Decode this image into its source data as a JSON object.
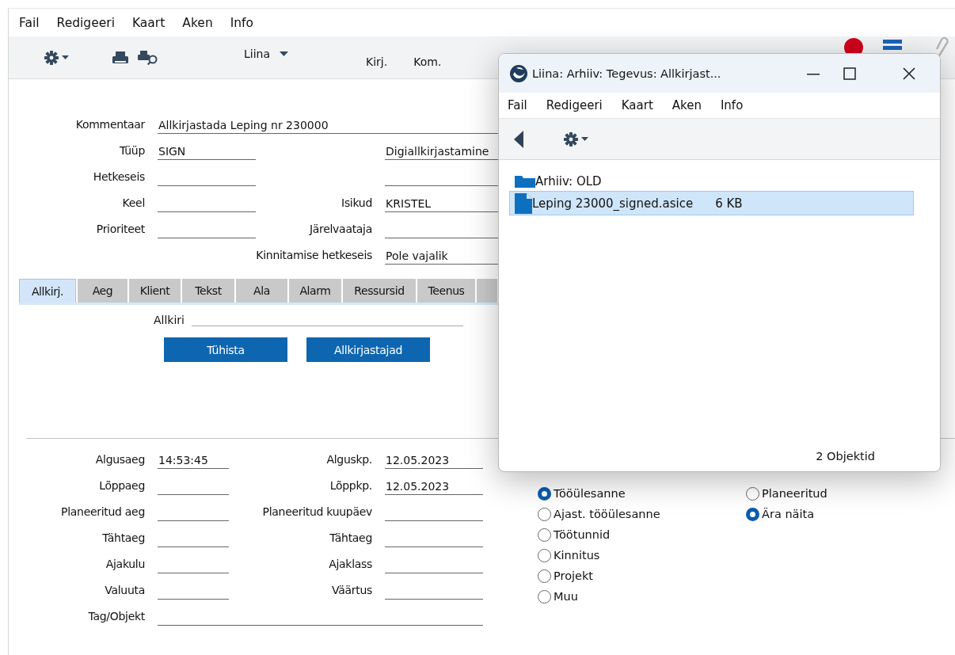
{
  "main_window": {
    "menu": [
      "Fail",
      "Redigeeri",
      "Kaart",
      "Aken",
      "Info"
    ],
    "toolbar": {
      "user_menu": "Liina",
      "buttons": [
        "Kirj.",
        "Kom."
      ]
    },
    "header_rows": [
      {
        "kind": "wide",
        "left": {
          "label": "Kommentaar",
          "value": "Allkirjastada Leping nr 230000"
        }
      },
      {
        "kind": "pair",
        "left": {
          "label": "Tüüp",
          "value": "SIGN"
        },
        "right": {
          "value": "Digiallkirjastamine"
        }
      },
      {
        "kind": "pair",
        "left": {
          "label": "Hetkeseis"
        },
        "right": {
          "kind": "field"
        }
      },
      {
        "kind": "pair",
        "left": {
          "label": "Keel"
        },
        "right": {
          "label": "Isikud",
          "value": "KRISTEL"
        }
      },
      {
        "kind": "pair",
        "left": {
          "label": "Prioriteet"
        },
        "right": {
          "label": "Järelvaataja"
        }
      },
      {
        "kind": "pair",
        "right": {
          "label": "Kinnitamise hetkeseis",
          "value": "Pole vajalik"
        }
      }
    ],
    "tabs": [
      {
        "label": "Allkirj.",
        "selected": true
      },
      {
        "label": "Aeg",
        "selected": false
      },
      {
        "label": "Klient",
        "selected": false
      },
      {
        "label": "Tekst",
        "selected": false
      },
      {
        "label": "Ala",
        "selected": false
      },
      {
        "label": "Alarm",
        "selected": false
      },
      {
        "label": "Ressursid",
        "selected": false
      },
      {
        "label": "Teenus",
        "selected": false
      }
    ],
    "signature": {
      "label": "Allkiri",
      "buttons": [
        "Tühista",
        "Allkirjastajad"
      ]
    },
    "time_rows": [
      {
        "kind": "pair",
        "left": {
          "label": "Algusaeg",
          "value": "14:53:45"
        },
        "right": {
          "label": "Alguskp.",
          "value": "12.05.2023"
        }
      },
      {
        "kind": "pair",
        "left": {
          "label": "Lõppaeg"
        },
        "right": {
          "label": "Lõppkp.",
          "value": "12.05.2023"
        }
      },
      {
        "kind": "pair",
        "left": {
          "label": "Planeeritud aeg"
        },
        "right": {
          "label": "Planeeritud kuupäev"
        }
      },
      {
        "kind": "pair",
        "left": {
          "label": "Tähtaeg"
        },
        "right": {
          "label": "Tähtaeg"
        }
      },
      {
        "kind": "pair",
        "left": {
          "label": "Ajakulu"
        },
        "right": {
          "label": "Ajaklass"
        }
      },
      {
        "kind": "pair",
        "left": {
          "label": "Valuuta"
        },
        "right": {
          "label": "Väärtus"
        }
      },
      {
        "kind": "wide",
        "left": {
          "label": "Tag/Objekt"
        }
      }
    ],
    "radio_groups": [
      {
        "options": [
          {
            "label": "Tööülesanne",
            "selected": true
          },
          {
            "label": "Ajast. tööülesanne",
            "selected": false
          },
          {
            "label": "Töötunnid",
            "selected": false
          },
          {
            "label": "Kinnitus",
            "selected": false
          },
          {
            "label": "Projekt",
            "selected": false
          },
          {
            "label": "Muu",
            "selected": false
          }
        ]
      },
      {
        "options": [
          {
            "label": "Planeeritud",
            "selected": false
          },
          {
            "label": "Ära näita",
            "selected": true
          }
        ]
      }
    ]
  },
  "popup_window": {
    "title": "Liina: Arhiiv: Tegevus: Allkirjast...",
    "menu": [
      "Fail",
      "Redigeeri",
      "Kaart",
      "Aken",
      "Info"
    ],
    "items": [
      {
        "kind": "folder",
        "name": "Arhiiv: OLD",
        "selected": false
      },
      {
        "kind": "file",
        "name": "Leping 23000_signed.asice",
        "size": "6 KB",
        "selected": true
      }
    ],
    "status": "2 Objektid"
  }
}
